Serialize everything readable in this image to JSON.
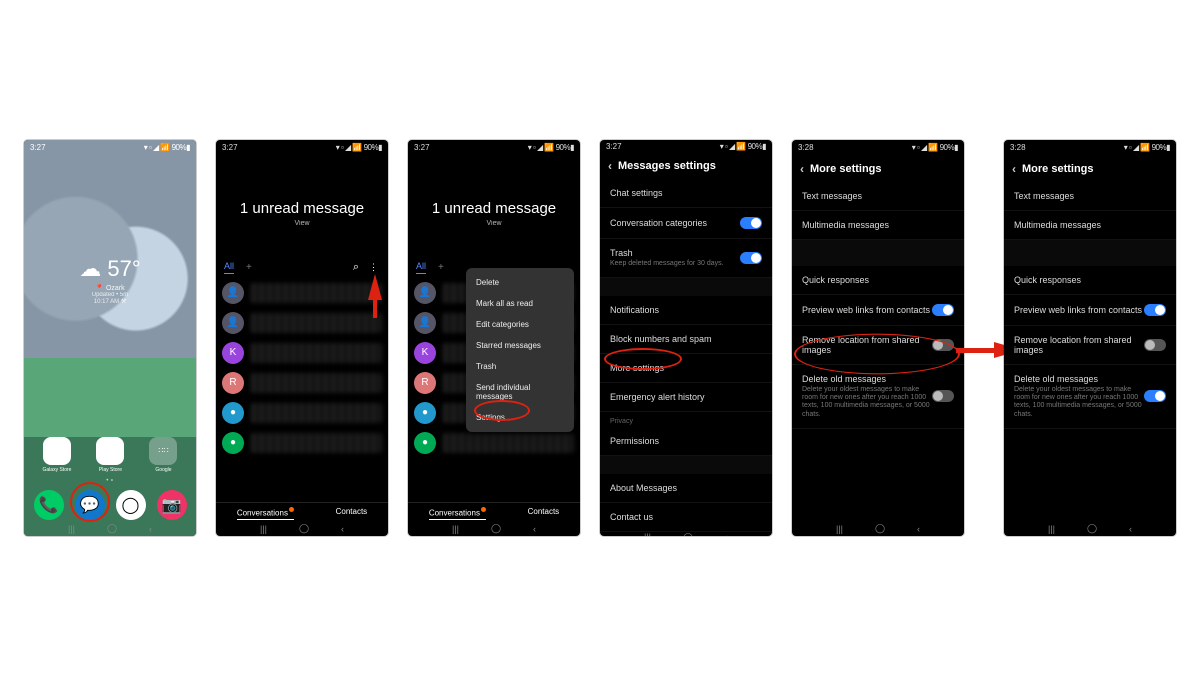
{
  "status": {
    "t2": "3:27",
    "t3": "3:27",
    "t4": "3:27",
    "t5": "3:28",
    "t6": "3:28",
    "right": "▾ ▫ ◢ 📶 90%▮"
  },
  "home": {
    "temp": "☁ 57°",
    "location": "📍 Ozark",
    "updated": "Updated • 5m",
    "time": "10:17 AM ⚒",
    "apps": {
      "a1": "Galaxy Store",
      "a2": "Play Store",
      "a3": "Google"
    },
    "dock": {
      "phone": "📞",
      "msg": "💬",
      "chrome": "●",
      "camera": "📷"
    }
  },
  "messages": {
    "title": "1 unread message",
    "view": "View",
    "tab_all": "All",
    "tabs": {
      "conversations": "Conversations",
      "contacts": "Contacts"
    },
    "menu": [
      "Delete",
      "Mark all as read",
      "Edit categories",
      "Starred messages",
      "Trash",
      "Send individual messages",
      "Settings"
    ]
  },
  "msg_settings": {
    "title": "Messages settings",
    "rows": {
      "chat": "Chat settings",
      "cats": "Conversation categories",
      "trash": "Trash",
      "trash_sub": "Keep deleted messages for 30 days.",
      "notif": "Notifications",
      "block": "Block numbers and spam",
      "more": "More settings",
      "emerg": "Emergency alert history",
      "privacy": "Privacy",
      "perm": "Permissions",
      "about": "About Messages",
      "contact": "Contact us"
    }
  },
  "more": {
    "title": "More settings",
    "text": "Text messages",
    "mms": "Multimedia messages",
    "quick": "Quick responses",
    "preview": "Preview web links from contacts",
    "removeloc": "Remove location from shared images",
    "del": "Delete old messages",
    "del_sub": "Delete your oldest messages to make room for new ones after you reach 1000 texts, 100 multimedia messages, or 5000 chats."
  }
}
